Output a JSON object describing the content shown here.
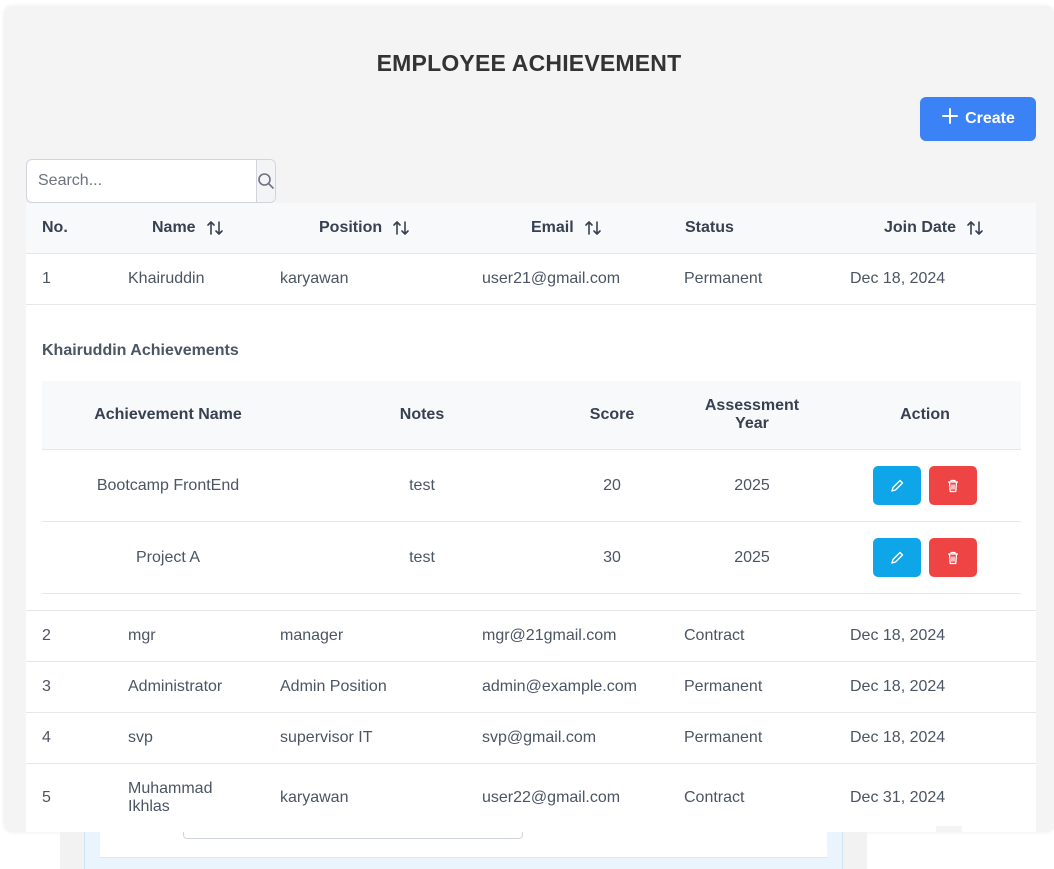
{
  "page": {
    "title": "EMPLOYEE ACHIEVEMENT"
  },
  "toolbar": {
    "create_label": "Create"
  },
  "search": {
    "placeholder": "Search..."
  },
  "table": {
    "columns": [
      "No.",
      "Name",
      "Position",
      "Email",
      "Status",
      "Join Date"
    ],
    "rows": [
      {
        "no": "1",
        "name": "Khairuddin",
        "position": "karyawan",
        "email": "user21@gmail.com",
        "status": "Permanent",
        "join_date": "Dec 18, 2024"
      },
      {
        "no": "2",
        "name": "mgr",
        "position": "manager",
        "email": "mgr@21gmail.com",
        "status": "Contract",
        "join_date": "Dec 18, 2024"
      },
      {
        "no": "3",
        "name": "Administrator",
        "position": "Admin Position",
        "email": "admin@example.com",
        "status": "Permanent",
        "join_date": "Dec 18, 2024"
      },
      {
        "no": "4",
        "name": "svp",
        "position": "supervisor IT",
        "email": "svp@gmail.com",
        "status": "Permanent",
        "join_date": "Dec 18, 2024"
      },
      {
        "no": "5",
        "name_line1": "Muhammad",
        "name_line2": "Ikhlas",
        "position": "karyawan",
        "email": "user22@gmail.com",
        "status": "Contract",
        "join_date": "Dec 31, 2024"
      }
    ]
  },
  "achievements": {
    "title": "Khairuddin Achievements",
    "columns": {
      "name": "Achievement Name",
      "notes": "Notes",
      "score": "Score",
      "year_line1": "Assessment",
      "year_line2": "Year",
      "action": "Action"
    },
    "rows": [
      {
        "name": "Bootcamp FrontEnd",
        "notes": "test",
        "score": "20",
        "year": "2025"
      },
      {
        "name": "Project A",
        "notes": "test",
        "score": "30",
        "year": "2025"
      }
    ]
  },
  "colors": {
    "primary": "#3b82f6",
    "edit": "#0ea5e9",
    "delete": "#ef4444"
  },
  "icons": {
    "create": "plus-icon",
    "search": "search-icon",
    "sort": "sort-icon",
    "edit": "pencil-icon",
    "delete": "trash-icon"
  }
}
